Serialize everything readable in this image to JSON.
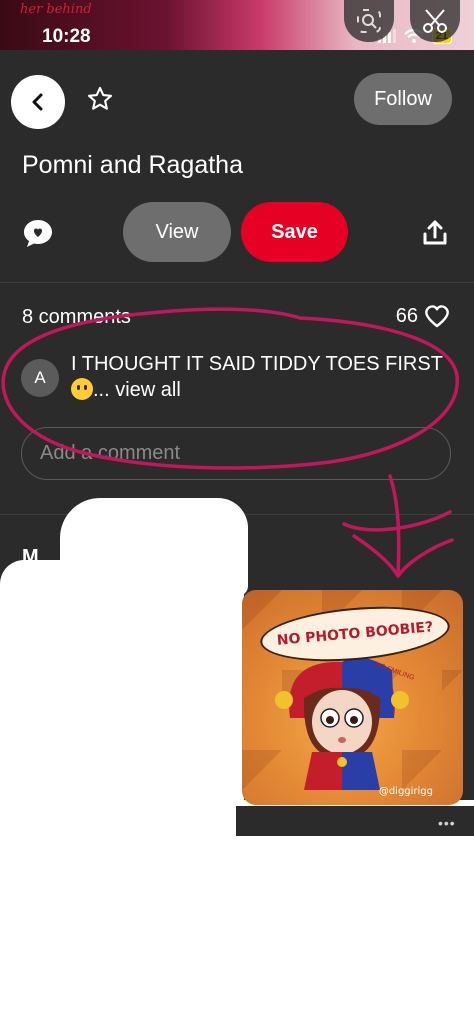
{
  "status_bar": {
    "caption": "her behind",
    "time": "10:28",
    "battery": "21"
  },
  "header": {
    "follow_label": "Follow"
  },
  "pin": {
    "title": "Pomni and Ragatha"
  },
  "actions": {
    "view_label": "View",
    "save_label": "Save"
  },
  "comments": {
    "count_label": "8 comments",
    "likes": "66",
    "items": [
      {
        "avatar": "A",
        "text_main": "I THOUGHT IT SAID TIDDY TOES FIRST",
        "text_tail": "... view all"
      }
    ],
    "input_placeholder": "Add a comment"
  },
  "more": {
    "label": "M"
  },
  "thumbnail": {
    "bubble_text": "NO PHOTO BOOBIE?",
    "tag_text": "NO SMILING",
    "credit": "@diggirigg"
  },
  "colors": {
    "background": "#2b2b2b",
    "save": "#e60023",
    "pill": "#6e6e6e",
    "annotation": "#c2185b"
  },
  "icons": [
    "search-lens-icon",
    "scissors-icon",
    "chevron-left-icon",
    "star-icon",
    "chat-bubble-icon",
    "share-icon",
    "heart-icon",
    "more-dots-icon"
  ]
}
